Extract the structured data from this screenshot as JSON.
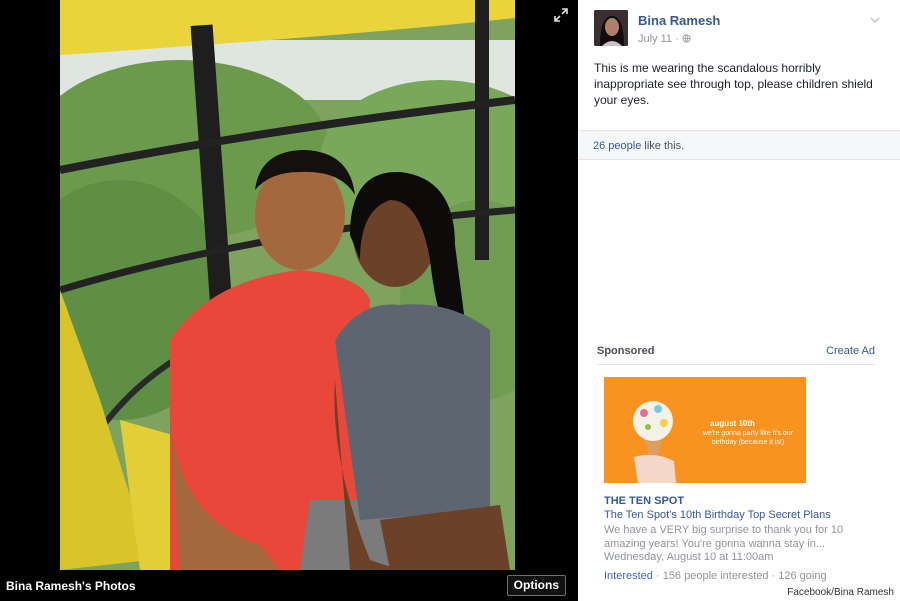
{
  "viewer": {
    "album_title": "Bina Ramesh's Photos",
    "options_label": "Options"
  },
  "post": {
    "author": "Bina Ramesh",
    "date": "July 11",
    "privacy_separator": "·",
    "text": "This is me wearing the scandalous horribly inappropriate see through top, please children shield your eyes."
  },
  "likes": {
    "count": "26 people",
    "suffix": " like this."
  },
  "sponsored": {
    "label": "Sponsored",
    "create_ad": "Create Ad",
    "ad": {
      "image_line1": "august 10th",
      "image_line2": "we're gonna party like it's our birthday (because it is!)",
      "title": "THE TEN SPOT",
      "subtitle": "The Ten Spot's 10th Birthday Top Secret Plans",
      "body": "We have a VERY big surprise to thank you for 10 amazing years! You're gonna wanna stay in...",
      "date": "Wednesday, August 10 at 11:00am",
      "interested": "Interested",
      "stats": " · 156 people interested · 126 going"
    }
  },
  "credit": "Facebook/Bina Ramesh",
  "colors": {
    "link": "#365899",
    "ad_orange": "#f7931e",
    "shirt_red": "#e8473a"
  },
  "icons": [
    "expand-icon",
    "chevron-down-icon",
    "globe-icon"
  ]
}
